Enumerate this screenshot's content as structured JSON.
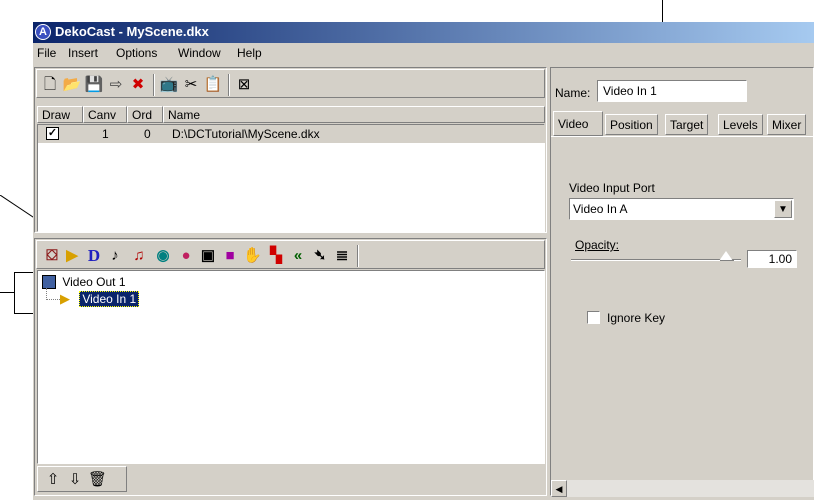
{
  "window": {
    "title": "DekoCast - MyScene.dkx",
    "app_icon": "A"
  },
  "menu": [
    "File",
    "Insert",
    "Options",
    "Window",
    "Help"
  ],
  "scene_list": {
    "columns": [
      "Draw",
      "Canv",
      "Ord",
      "Name"
    ],
    "rows": [
      {
        "draw": "☑",
        "canv": "1",
        "ord": "0",
        "name": "D:\\DCTutorial\\MyScene.dkx"
      }
    ]
  },
  "layer_tree": {
    "items": [
      {
        "label": "Video Out 1"
      },
      {
        "label": "Video In 1"
      }
    ]
  },
  "properties": {
    "name_label": "Name:",
    "name_value": "Video In 1",
    "tabs": [
      "Video",
      "Position",
      "Target",
      "Levels",
      "Mixer"
    ],
    "active_tab": "Video",
    "video_input_port_label": "Video Input Port",
    "video_input_port_value": "Video In A",
    "opacity_label": "Opacity:",
    "opacity_value": "1.00",
    "ignore_key_label": "Ignore Key"
  },
  "icons": {
    "new": "🗋",
    "open": "📂",
    "save": "💾",
    "add-scene": "⇨",
    "remove-scene": "✖",
    "layer-text": "D",
    "up": "⇧",
    "down": "⇩",
    "delete": "🗑"
  }
}
